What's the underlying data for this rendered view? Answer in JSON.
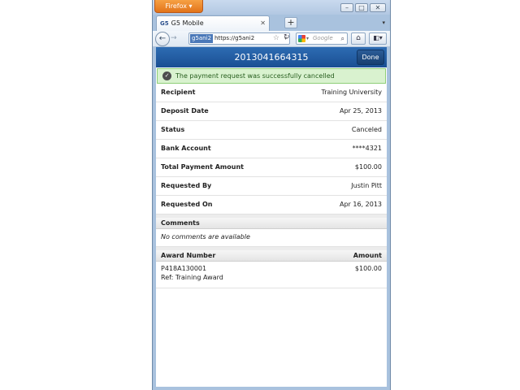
{
  "browser": {
    "app_button_label": "Firefox",
    "tab_title": "G5 Mobile",
    "tab_favicon": "G5",
    "new_tab_label": "+",
    "url_site_id": "g5ani2",
    "url_text": "https://g5ani2",
    "search_placeholder": "Google"
  },
  "header": {
    "title": "2013041664315",
    "done_label": "Done"
  },
  "alert": {
    "message": "The payment request was successfully cancelled"
  },
  "details": [
    {
      "label": "Recipient",
      "value": "Training University"
    },
    {
      "label": "Deposit Date",
      "value": "Apr 25, 2013"
    },
    {
      "label": "Status",
      "value": "Canceled"
    },
    {
      "label": "Bank Account",
      "value": "****4321"
    },
    {
      "label": "Total Payment Amount",
      "value": "$100.00"
    },
    {
      "label": "Requested By",
      "value": "Justin Pitt"
    },
    {
      "label": "Requested On",
      "value": "Apr 16, 2013"
    }
  ],
  "comments": {
    "heading": "Comments",
    "empty_text": "No comments are available"
  },
  "awards": {
    "col_number": "Award Number",
    "col_amount": "Amount",
    "rows": [
      {
        "number": "P418A130001",
        "ref": "Ref: Training Award",
        "amount": "$100.00"
      }
    ]
  },
  "colors": {
    "header_blue": "#1a4f93",
    "alert_green_bg": "#d9f2cf",
    "alert_green_border": "#8fcf78",
    "firefox_orange": "#e2731a"
  }
}
